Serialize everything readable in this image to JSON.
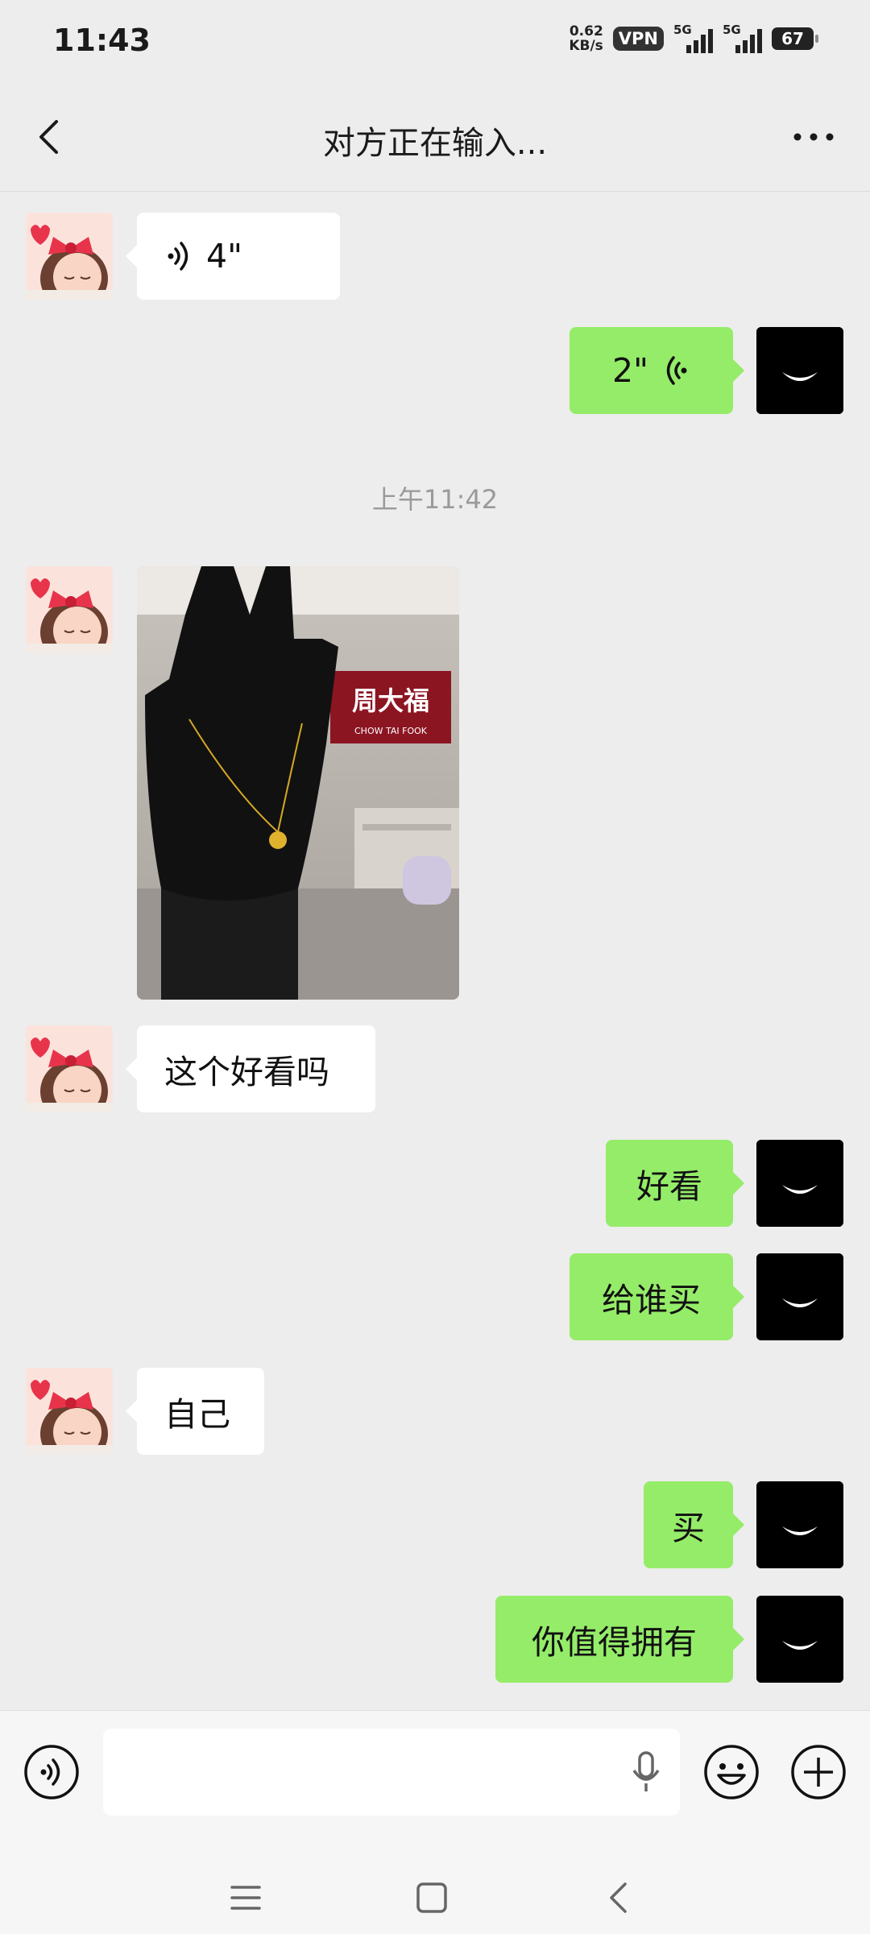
{
  "status_bar": {
    "time": "11:43",
    "net_speed_value": "0.62",
    "net_speed_unit": "KB/s",
    "vpn": "VPN",
    "signal1_label": "5G",
    "signal2_label": "5G",
    "battery": "67"
  },
  "header": {
    "title": "对方正在输入..."
  },
  "messages": [
    {
      "side": "in",
      "type": "voice",
      "text": "4\""
    },
    {
      "side": "out",
      "type": "voice",
      "text": "2\""
    },
    {
      "type": "timestamp",
      "text": "上午11:42"
    },
    {
      "side": "in",
      "type": "image",
      "image_sign_text": "周大福",
      "image_sign_sub": "CHOW TAI FOOK"
    },
    {
      "side": "in",
      "type": "text",
      "text": "这个好看吗"
    },
    {
      "side": "out",
      "type": "text",
      "text": "好看"
    },
    {
      "side": "out",
      "type": "text",
      "text": "给谁买"
    },
    {
      "side": "in",
      "type": "text",
      "text": "自己"
    },
    {
      "side": "out",
      "type": "text",
      "text": "买"
    },
    {
      "side": "out",
      "type": "text",
      "text": "你值得拥有"
    }
  ],
  "colors": {
    "background": "#ededed",
    "outgoing_bubble": "#95ec69",
    "incoming_bubble": "#ffffff"
  },
  "icons": {
    "back": "chevron-left-icon",
    "more": "more-dots-icon",
    "voice_toggle": "voice-toggle-icon",
    "mic": "mic-icon",
    "emoji": "emoji-icon",
    "add": "plus-circle-icon"
  }
}
